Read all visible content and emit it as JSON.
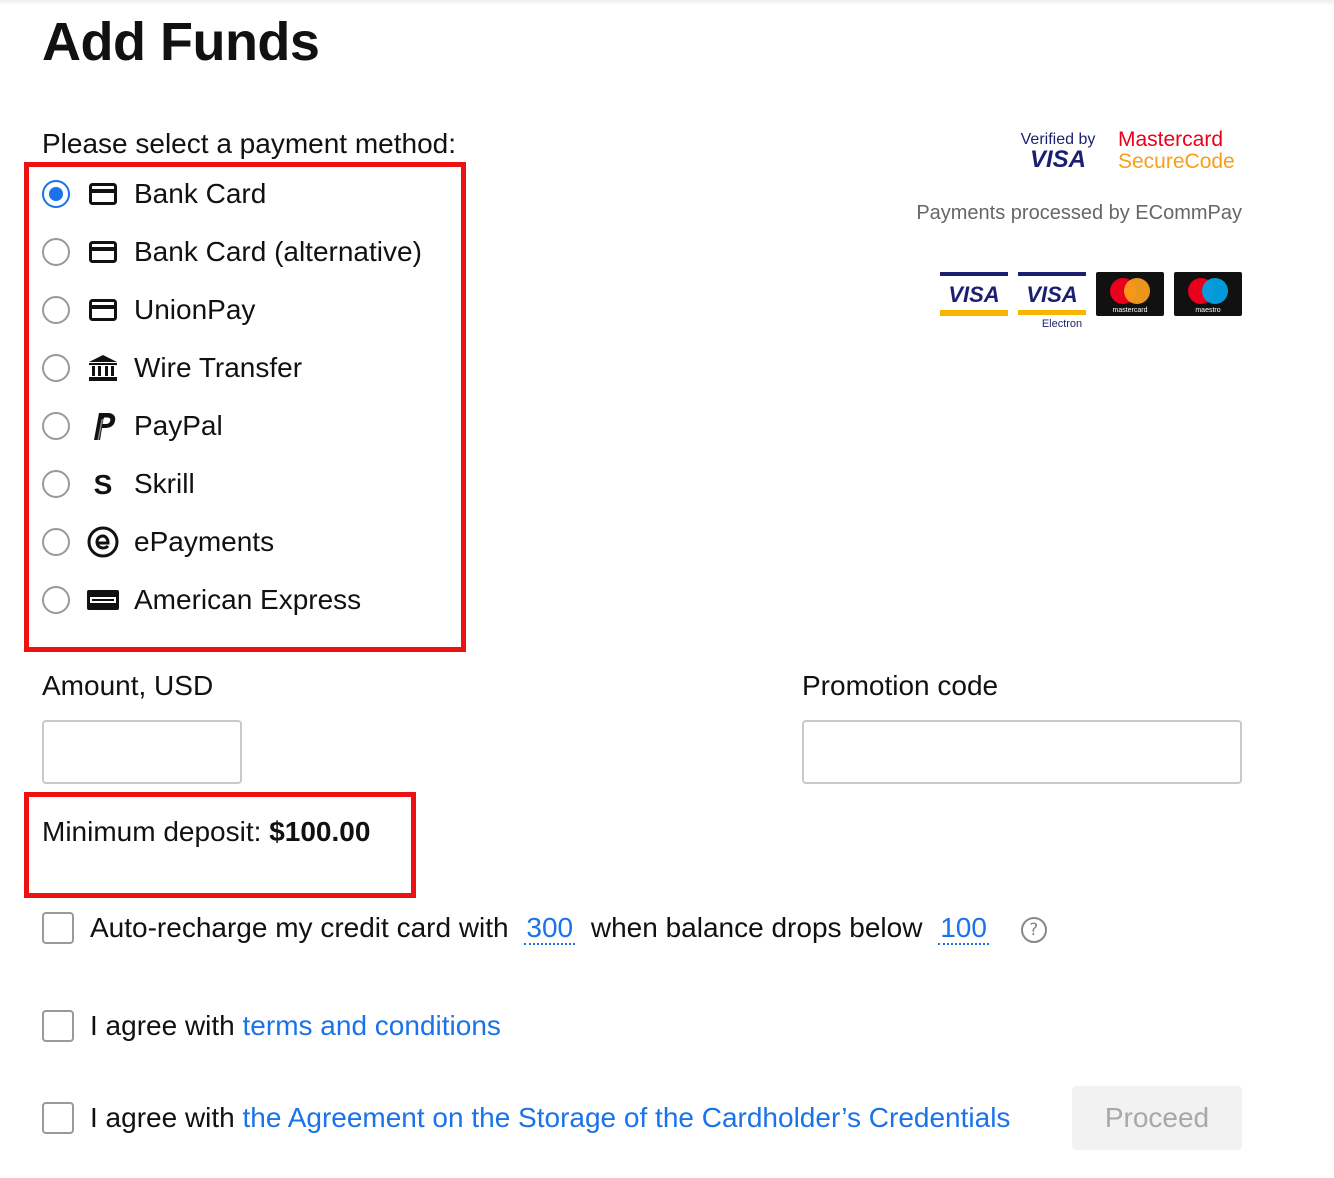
{
  "page": {
    "title": "Add Funds"
  },
  "payment": {
    "prompt": "Please select a payment method:",
    "selected": "Bank Card",
    "methods": [
      {
        "label": "Bank Card",
        "icon": "credit-card-icon",
        "checked": true
      },
      {
        "label": "Bank Card (alternative)",
        "icon": "credit-card-icon",
        "checked": false
      },
      {
        "label": "UnionPay",
        "icon": "credit-card-icon",
        "checked": false
      },
      {
        "label": "Wire Transfer",
        "icon": "bank-icon",
        "checked": false
      },
      {
        "label": "PayPal",
        "icon": "paypal-icon",
        "checked": false
      },
      {
        "label": "Skrill",
        "icon": "skrill-icon",
        "checked": false
      },
      {
        "label": "ePayments",
        "icon": "epayments-icon",
        "checked": false
      },
      {
        "label": "American Express",
        "icon": "amex-icon",
        "checked": false
      }
    ]
  },
  "security": {
    "vbv_line1": "Verified by",
    "vbv_line2": "VISA",
    "mc_line1": "Mastercard",
    "mc_line2": "SecureCode",
    "processed_by": "Payments processed by ECommPay",
    "cards": [
      {
        "name": "visa-logo",
        "text": "VISA"
      },
      {
        "name": "visa-electron-logo",
        "text": "VISA",
        "sub": "Electron"
      },
      {
        "name": "mastercard-logo",
        "sub": "mastercard"
      },
      {
        "name": "maestro-logo",
        "sub": "maestro"
      }
    ]
  },
  "amount": {
    "label": "Amount, USD",
    "value": "",
    "placeholder": ""
  },
  "promo": {
    "label": "Promotion code",
    "value": "",
    "placeholder": ""
  },
  "minimum": {
    "prefix": "Minimum deposit: ",
    "amount": "$100.00"
  },
  "autorecharge": {
    "checked": false,
    "text1": "Auto-recharge my credit card with",
    "amount": "300",
    "text2": "when balance drops below",
    "threshold": "100",
    "help": "?"
  },
  "terms": {
    "checked": false,
    "prefix": "I agree with ",
    "link": "terms and conditions"
  },
  "storage": {
    "checked": false,
    "prefix": "I agree with ",
    "link": "the Agreement on the Storage of the Cardholder’s Credentials"
  },
  "actions": {
    "proceed": "Proceed"
  },
  "colors": {
    "accent": "#1a73e8",
    "highlight": "#ee1111",
    "mastercard_red": "#eb001b",
    "mastercard_orange": "#f79e1b",
    "visa_blue": "#1a1f71"
  }
}
